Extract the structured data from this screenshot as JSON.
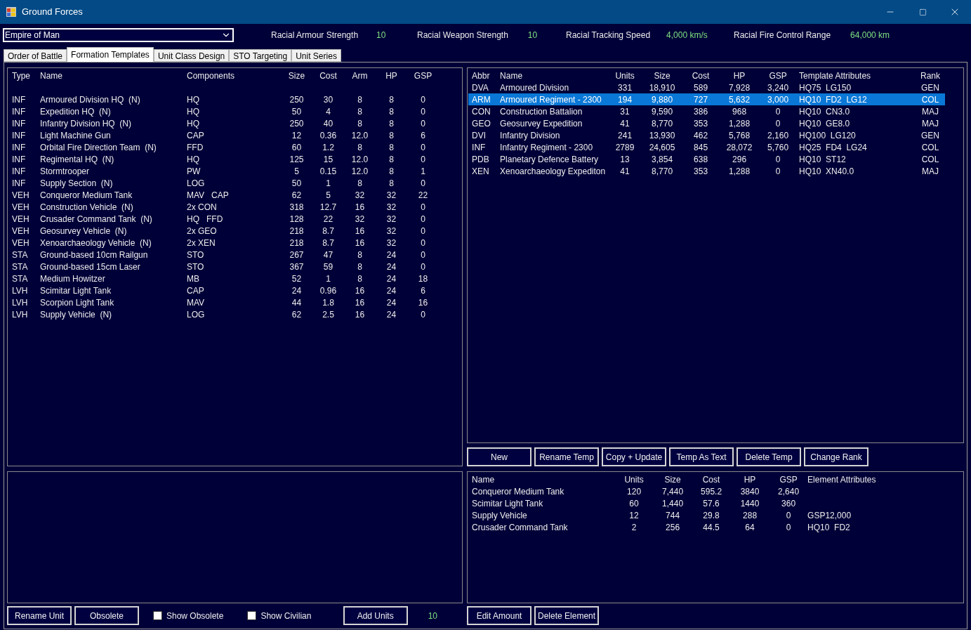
{
  "window": {
    "title": "Ground Forces"
  },
  "race_select": {
    "value": "Empire of Man"
  },
  "racial_stats": [
    {
      "label": "Racial Armour Strength",
      "value": "10"
    },
    {
      "label": "Racial Weapon Strength",
      "value": "10"
    },
    {
      "label": "Racial Tracking Speed",
      "value": "4,000 km/s"
    },
    {
      "label": "Racial Fire Control Range",
      "value": "64,000 km"
    }
  ],
  "tabs": [
    {
      "label": "Order of Battle",
      "selected": false
    },
    {
      "label": "Formation Templates",
      "selected": true
    },
    {
      "label": "Unit Class Design",
      "selected": false
    },
    {
      "label": "STO Targeting",
      "selected": false
    },
    {
      "label": "Unit Series",
      "selected": false
    }
  ],
  "unit_classes": {
    "columns": [
      "Type",
      "Name",
      "Components",
      "Size",
      "Cost",
      "Arm",
      "HP",
      "GSP"
    ],
    "rows": [
      [
        "INF",
        "Armoured Division HQ  (N)",
        "HQ",
        "250",
        "30",
        "8",
        "8",
        "0"
      ],
      [
        "INF",
        "Expedition HQ  (N)",
        "HQ",
        "50",
        "4",
        "8",
        "8",
        "0"
      ],
      [
        "INF",
        "Infantry Division HQ  (N)",
        "HQ",
        "250",
        "40",
        "8",
        "8",
        "0"
      ],
      [
        "INF",
        "Light Machine Gun",
        "CAP",
        "12",
        "0.36",
        "12.0",
        "8",
        "6"
      ],
      [
        "INF",
        "Orbital Fire Direction Team  (N)",
        "FFD",
        "60",
        "1.2",
        "8",
        "8",
        "0"
      ],
      [
        "INF",
        "Regimental HQ  (N)",
        "HQ",
        "125",
        "15",
        "12.0",
        "8",
        "0"
      ],
      [
        "INF",
        "Stormtrooper",
        "PW",
        "5",
        "0.15",
        "12.0",
        "8",
        "1"
      ],
      [
        "INF",
        "Supply Section  (N)",
        "LOG",
        "50",
        "1",
        "8",
        "8",
        "0"
      ],
      [
        "VEH",
        "Conqueror Medium Tank",
        "MAV   CAP",
        "62",
        "5",
        "32",
        "32",
        "22"
      ],
      [
        "VEH",
        "Construction Vehicle  (N)",
        "2x CON",
        "318",
        "12.7",
        "16",
        "32",
        "0"
      ],
      [
        "VEH",
        "Crusader Command Tank  (N)",
        "HQ   FFD",
        "128",
        "22",
        "32",
        "32",
        "0"
      ],
      [
        "VEH",
        "Geosurvey Vehicle  (N)",
        "2x GEO",
        "218",
        "8.7",
        "16",
        "32",
        "0"
      ],
      [
        "VEH",
        "Xenoarchaeology Vehicle  (N)",
        "2x XEN",
        "218",
        "8.7",
        "16",
        "32",
        "0"
      ],
      [
        "STA",
        "Ground-based 10cm Railgun",
        "STO",
        "267",
        "47",
        "8",
        "24",
        "0"
      ],
      [
        "STA",
        "Ground-based 15cm Laser",
        "STO",
        "367",
        "59",
        "8",
        "24",
        "0"
      ],
      [
        "STA",
        "Medium Howitzer",
        "MB",
        "52",
        "1",
        "8",
        "24",
        "18"
      ],
      [
        "LVH",
        "Scimitar Light Tank",
        "CAP",
        "24",
        "0.96",
        "16",
        "24",
        "6"
      ],
      [
        "LVH",
        "Scorpion Light Tank",
        "MAV",
        "44",
        "1.8",
        "16",
        "24",
        "16"
      ],
      [
        "LVH",
        "Supply Vehicle  (N)",
        "LOG",
        "62",
        "2.5",
        "16",
        "24",
        "0"
      ]
    ]
  },
  "templates": {
    "columns": [
      "Abbr",
      "Name",
      "Units",
      "Size",
      "Cost",
      "HP",
      "GSP",
      "Template Attributes",
      "Rank"
    ],
    "rows": [
      {
        "selected": false,
        "cells": [
          "DVA",
          "Armoured Division",
          "331",
          "18,910",
          "589",
          "7,928",
          "3,240",
          "HQ75  LG150",
          "GEN"
        ]
      },
      {
        "selected": true,
        "cells": [
          "ARM",
          "Armoured Regiment - 2300",
          "194",
          "9,880",
          "727",
          "5,632",
          "3,000",
          "HQ10  FD2  LG12",
          "COL"
        ]
      },
      {
        "selected": false,
        "cells": [
          "CON",
          "Construction Battalion",
          "31",
          "9,590",
          "386",
          "968",
          "0",
          "HQ10  CN3.0",
          "MAJ"
        ]
      },
      {
        "selected": false,
        "cells": [
          "GEO",
          "Geosurvey Expedition",
          "41",
          "8,770",
          "353",
          "1,288",
          "0",
          "HQ10  GE8.0",
          "MAJ"
        ]
      },
      {
        "selected": false,
        "cells": [
          "DVI",
          "Infantry Division",
          "241",
          "13,930",
          "462",
          "5,768",
          "2,160",
          "HQ100  LG120",
          "GEN"
        ]
      },
      {
        "selected": false,
        "cells": [
          "INF",
          "Infantry Regiment - 2300",
          "2789",
          "24,605",
          "845",
          "28,072",
          "5,760",
          "HQ25  FD4  LG24",
          "COL"
        ]
      },
      {
        "selected": false,
        "cells": [
          "PDB",
          "Planetary Defence Battery",
          "13",
          "3,854",
          "638",
          "296",
          "0",
          "HQ10  ST12",
          "COL"
        ]
      },
      {
        "selected": false,
        "cells": [
          "XEN",
          "Xenoarchaeology Expediton",
          "41",
          "8,770",
          "353",
          "1,288",
          "0",
          "HQ10  XN40.0",
          "MAJ"
        ]
      }
    ]
  },
  "template_buttons": [
    "New",
    "Rename Temp",
    "Copy + Update",
    "Temp As Text",
    "Delete Temp",
    "Change Rank"
  ],
  "elements": {
    "columns": [
      "Name",
      "Units",
      "Size",
      "Cost",
      "HP",
      "GSP",
      "Element Attributes"
    ],
    "rows": [
      [
        "Conqueror Medium Tank",
        "120",
        "7,440",
        "595.2",
        "3840",
        "2,640",
        null
      ],
      [
        "Scimitar Light Tank",
        "60",
        "1,440",
        "57.6",
        "1440",
        "360",
        null
      ],
      [
        "Supply Vehicle",
        "12",
        "744",
        "29.8",
        "288",
        "0",
        "GSP12,000"
      ],
      [
        "Crusader Command Tank",
        "2",
        "256",
        "44.5",
        "64",
        "0",
        "HQ10  FD2"
      ]
    ]
  },
  "unit_buttons": [
    "Rename Unit",
    "Obsolete"
  ],
  "checkboxes": [
    {
      "label": "Show Obsolete",
      "checked": false
    },
    {
      "label": "Show Civilian",
      "checked": false
    }
  ],
  "add_units": {
    "label": "Add Units",
    "amount": "10"
  },
  "element_buttons": [
    "Edit Amount",
    "Delete Element"
  ]
}
